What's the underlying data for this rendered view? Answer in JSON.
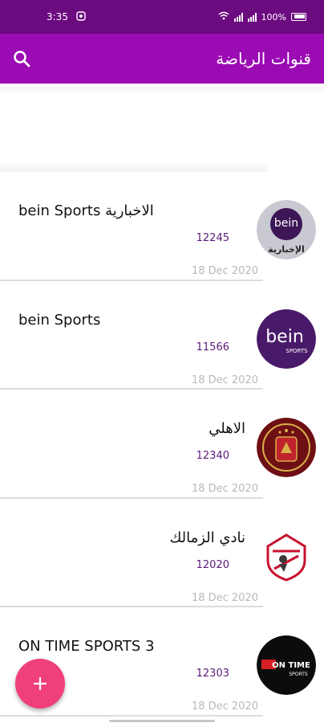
{
  "status_bar": {
    "time": "3:35",
    "battery": "100%",
    "icons": [
      "notification-icon",
      "wifi-icon",
      "signal-icon",
      "battery-icon"
    ]
  },
  "app_bar": {
    "title": "قنوات الرياضة",
    "search_icon": "search-icon",
    "color": "#9a0bb3"
  },
  "channels": [
    {
      "name": "bein Sports الاخبارية",
      "number": "12245",
      "date": "18 Dec 2020",
      "logo": "bein-news-logo",
      "rtl": false
    },
    {
      "name": "bein Sports",
      "number": "11566",
      "date": "18 Dec 2020",
      "logo": "bein-sports-logo",
      "rtl": false
    },
    {
      "name": "الاهلي",
      "number": "12340",
      "date": "18 Dec 2020",
      "logo": "al-ahly-logo",
      "rtl": true
    },
    {
      "name": "نادي الزمالك",
      "number": "12020",
      "date": "18 Dec 2020",
      "logo": "zamalek-logo",
      "rtl": true
    },
    {
      "name": "ON TIME SPORTS 3",
      "number": "12303",
      "date": "18 Dec 2020",
      "logo": "ontime-sports-logo",
      "rtl": false
    }
  ],
  "logos": {
    "bein_news_caption": "الإخبارية",
    "bein_text": "bein",
    "sports_text": "SPORTS",
    "ontime_text": "ON TIME",
    "ontime_sub": "SPORTS"
  },
  "fab": {
    "icon": "plus-icon",
    "color": "#f0407a"
  }
}
